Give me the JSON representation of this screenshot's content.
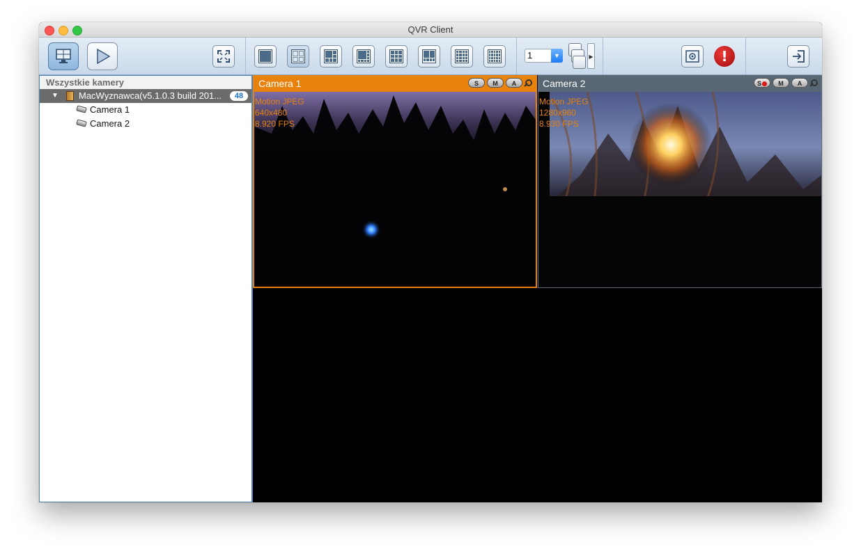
{
  "window": {
    "title": "QVR Client"
  },
  "toolbar": {
    "page_value": "1",
    "buttons": [
      {
        "name": "live-view",
        "icon": "monitor-icon"
      },
      {
        "name": "playback",
        "icon": "play-icon"
      },
      {
        "name": "fullscreen",
        "icon": "fullscreen-icon"
      },
      {
        "name": "layout-1",
        "icon": "layout-1x1-icon"
      },
      {
        "name": "layout-4",
        "icon": "layout-2x2-icon"
      },
      {
        "name": "layout-6",
        "icon": "layout-6-icon"
      },
      {
        "name": "layout-8",
        "icon": "layout-8-icon"
      },
      {
        "name": "layout-9",
        "icon": "layout-3x3-icon"
      },
      {
        "name": "layout-10",
        "icon": "layout-10-icon"
      },
      {
        "name": "layout-16",
        "icon": "layout-4x4-icon"
      },
      {
        "name": "layout-20",
        "icon": "layout-20-icon"
      },
      {
        "name": "sequential",
        "icon": "stacked-windows-icon"
      },
      {
        "name": "snapshot",
        "icon": "snapshot-icon"
      },
      {
        "name": "alert",
        "icon": "alert-icon"
      },
      {
        "name": "logout",
        "icon": "logout-icon"
      }
    ],
    "alert_glyph": "!"
  },
  "sidebar": {
    "header": "Wszystkie kamery",
    "server": {
      "toggle": "▼",
      "label": "MacWyznawca(v5.1.0.3 build 201...",
      "count": "48"
    },
    "cameras": [
      {
        "label": "Camera 1"
      },
      {
        "label": "Camera 2"
      }
    ]
  },
  "cameras": [
    {
      "title": "Camera 1",
      "pills": [
        "S",
        "M",
        "A"
      ],
      "osd": [
        "Motion JPEG",
        "640x480",
        "8.920 FPS"
      ],
      "accent": "#e8820c"
    },
    {
      "title": "Camera 2",
      "pills": [
        "S",
        "M",
        "A"
      ],
      "osd": [
        "Motion JPEG",
        "1280x960",
        "8.930 FPS"
      ],
      "accent": "#596774",
      "recording": true
    }
  ],
  "colors": {
    "accent_orange": "#e8820c",
    "toolbar_blue": "#c9d9ea",
    "rec_red": "#e01818"
  }
}
